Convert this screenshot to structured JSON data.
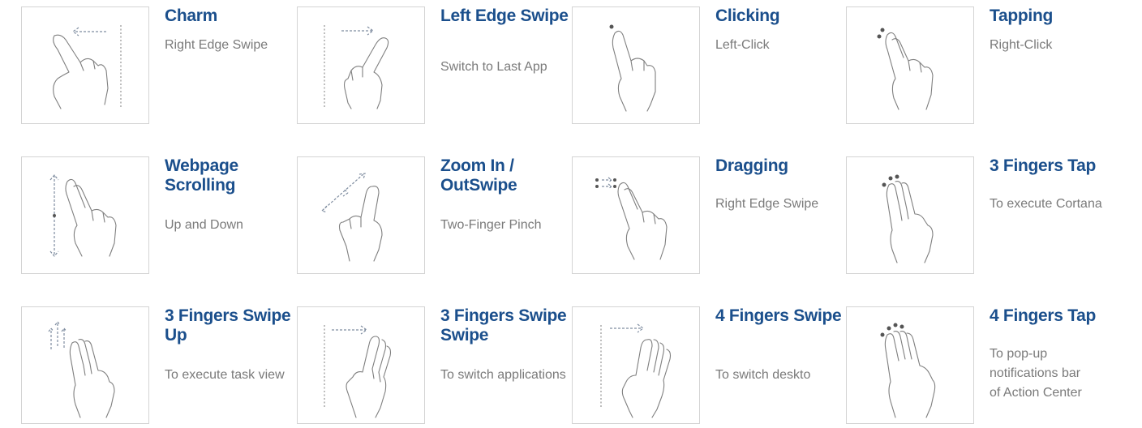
{
  "gestures": [
    {
      "title": "Charm",
      "desc": "Right Edge Swipe",
      "icon": "right-edge-swipe-icon"
    },
    {
      "title": "Left Edge Swipe",
      "desc": "Switch to Last App",
      "icon": "left-edge-swipe-icon"
    },
    {
      "title": "Clicking",
      "desc": "Left-Click",
      "icon": "one-finger-click-icon"
    },
    {
      "title": "Tapping",
      "desc": "Right-Click",
      "icon": "two-finger-tap-icon"
    },
    {
      "title": "Webpage Scrolling",
      "desc": "Up and Down",
      "icon": "two-finger-scroll-icon"
    },
    {
      "title": "Zoom In / OutSwipe",
      "desc": "Two-Finger Pinch",
      "icon": "pinch-zoom-icon"
    },
    {
      "title": "Dragging",
      "desc": "Right Edge Swipe",
      "icon": "two-finger-drag-icon"
    },
    {
      "title": "3 Fingers Tap",
      "desc": "To execute Cortana",
      "icon": "three-finger-tap-icon"
    },
    {
      "title": "3 Fingers Swipe Up",
      "desc": "To execute task view",
      "icon": "three-finger-swipe-up-icon"
    },
    {
      "title": "3 Fingers Swipe Swipe",
      "desc": "To switch applications",
      "icon": "three-finger-swipe-icon"
    },
    {
      "title": "4 Fingers Swipe",
      "desc": "To switch deskto",
      "icon": "four-finger-swipe-icon"
    },
    {
      "title": "4 Fingers Tap",
      "desc": "To pop-up notifications bar of Action Center",
      "icon": "four-finger-tap-icon"
    }
  ]
}
